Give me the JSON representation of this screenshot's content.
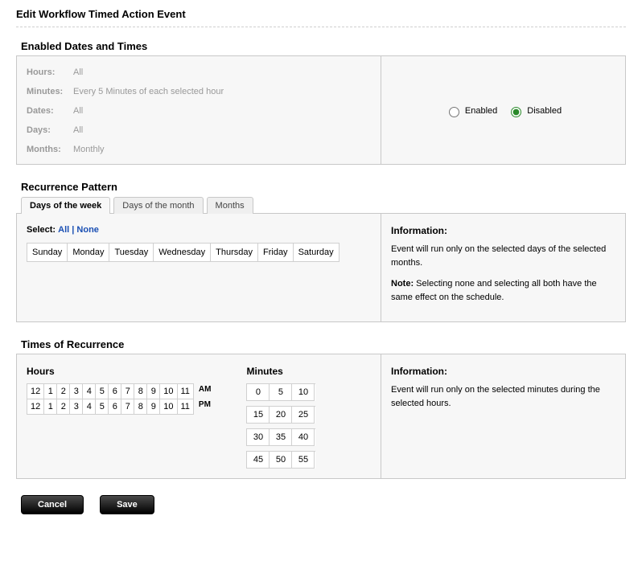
{
  "pageTitle": "Edit Workflow Timed Action Event",
  "enabledSection": {
    "title": "Enabled Dates and Times",
    "rows": [
      {
        "label": "Hours:",
        "value": "All"
      },
      {
        "label": "Minutes:",
        "value": "Every 5 Minutes of each selected hour"
      },
      {
        "label": "Dates:",
        "value": "All"
      },
      {
        "label": "Days:",
        "value": "All"
      },
      {
        "label": "Months:",
        "value": "Monthly"
      }
    ],
    "radios": {
      "enabledLabel": "Enabled",
      "disabledLabel": "Disabled",
      "selected": "disabled"
    }
  },
  "recurrence": {
    "title": "Recurrence Pattern",
    "tabs": [
      {
        "label": "Days of the week",
        "active": true
      },
      {
        "label": "Days of the month",
        "active": false
      },
      {
        "label": "Months",
        "active": false
      }
    ],
    "selectLabel": "Select:",
    "allLabel": "All",
    "noneLabel": "None",
    "sep": "|",
    "days": [
      "Sunday",
      "Monday",
      "Tuesday",
      "Wednesday",
      "Thursday",
      "Friday",
      "Saturday"
    ],
    "infoTitle": "Information:",
    "infoBody": "Event will run only on the selected days of the selected months.",
    "noteLabel": "Note:",
    "noteBody": "Selecting none and selecting all both have the same effect on the schedule."
  },
  "times": {
    "title": "Times of Recurrence",
    "hoursTitle": "Hours",
    "minutesTitle": "Minutes",
    "hoursAM": [
      "12",
      "1",
      "2",
      "3",
      "4",
      "5",
      "6",
      "7",
      "8",
      "9",
      "10",
      "11"
    ],
    "hoursPM": [
      "12",
      "1",
      "2",
      "3",
      "4",
      "5",
      "6",
      "7",
      "8",
      "9",
      "10",
      "11"
    ],
    "amLabel": "AM",
    "pmLabel": "PM",
    "minutes": [
      [
        "0",
        "5",
        "10"
      ],
      [
        "15",
        "20",
        "25"
      ],
      [
        "30",
        "35",
        "40"
      ],
      [
        "45",
        "50",
        "55"
      ]
    ],
    "infoTitle": "Information:",
    "infoBody": "Event will run only on the selected minutes during the selected hours."
  },
  "buttons": {
    "cancel": "Cancel",
    "save": "Save"
  }
}
